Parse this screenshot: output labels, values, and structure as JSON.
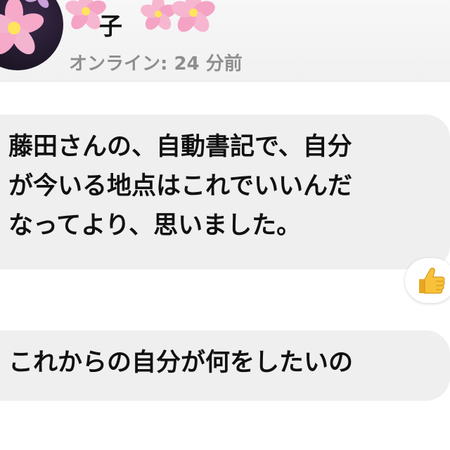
{
  "header": {
    "contact_name": "子",
    "status": "オンライン: 24 分前"
  },
  "messages": [
    {
      "lines": [
        "藤田さんの、自動書記で、自分",
        "が今いる地点はこれでいいんだ",
        "なってより、思いました。"
      ],
      "reaction_icon": "thumbs-up-icon"
    },
    {
      "lines": [
        "これからの自分が何をしたいの"
      ]
    }
  ],
  "colors": {
    "bubble_bg": "#efefef",
    "status_text": "#8e8e8e",
    "blossom_pink": "#f4a3c4",
    "thumb_yellow": "#f7c23a"
  }
}
